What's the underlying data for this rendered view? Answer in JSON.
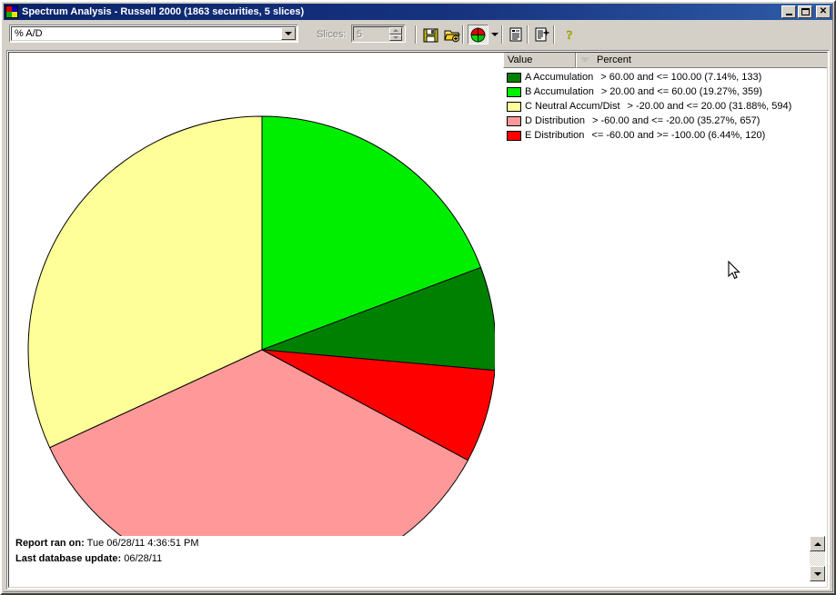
{
  "window": {
    "title": "Spectrum Analysis - Russell 2000 (1863 securities, 5 slices)",
    "app_icon": "pie-chart-icon",
    "buttons": {
      "minimize": "_",
      "maximize": "□",
      "close": "×"
    }
  },
  "toolbar": {
    "field_select": {
      "value": "% A/D",
      "icon": "chevron-down-icon"
    },
    "slices": {
      "label": "Slices:",
      "value": "5"
    },
    "buttons": [
      {
        "name": "save-button",
        "icon": "floppy-disk-icon"
      },
      {
        "name": "open-button",
        "icon": "open-folder-icon"
      },
      {
        "name": "pie-chart-view-button",
        "icon": "pie-chart-icon"
      },
      {
        "name": "chart-type-dropdown",
        "icon": "chevron-down-icon"
      },
      {
        "name": "report-view-button",
        "icon": "list-report-icon"
      },
      {
        "name": "detail-report-button",
        "icon": "add-report-icon"
      },
      {
        "name": "help-button",
        "icon": "question-mark-icon"
      }
    ]
  },
  "legend": {
    "columns": [
      "Value",
      "Percent"
    ],
    "sort_indicator": "sort-descending-icon",
    "rows": [
      {
        "color": "#008000",
        "name": "A Accumulation",
        "range": "> 60.00 and <= 100.00 (7.14%, 133)"
      },
      {
        "color": "#00ee00",
        "name": "B Accumulation",
        "range": "> 20.00 and <= 60.00 (19.27%, 359)"
      },
      {
        "color": "#ffff99",
        "name": "C Neutral Accum/Dist",
        "range": "> -20.00 and <= 20.00 (31.88%, 594)"
      },
      {
        "color": "#ff9999",
        "name": "D Distribution",
        "range": "> -60.00 and <= -20.00 (35.27%, 657)"
      },
      {
        "color": "#ff0000",
        "name": "E Distribution",
        "range": "<= -60.00 and >= -100.00 (6.44%, 120)"
      }
    ]
  },
  "footer": {
    "ran_label": "Report ran on:",
    "ran_value": "Tue 06/28/11 4:36:51 PM",
    "db_label": "Last database update:",
    "db_value": "06/28/11"
  },
  "scrollbar": {
    "up_icon": "scroll-up-arrow-icon",
    "down_icon": "scroll-down-arrow-icon"
  },
  "chart_data": {
    "type": "pie",
    "title": "Spectrum Analysis - Russell 2000",
    "total_securities": 1863,
    "slice_count": 5,
    "start_angle_deg": 0,
    "direction": "clockwise",
    "center": [
      278,
      327
    ],
    "radius": 257,
    "categories": [
      "B Accumulation",
      "A Accumulation",
      "E Distribution",
      "D Distribution",
      "C Neutral Accum/Dist"
    ],
    "values": [
      19.27,
      7.14,
      6.44,
      35.27,
      31.88
    ],
    "counts": [
      359,
      133,
      120,
      657,
      594
    ],
    "colors": [
      "#00ee00",
      "#008000",
      "#ff0000",
      "#ff9999",
      "#ffff99"
    ],
    "ranges": [
      "> 20.00 and <= 60.00",
      "> 60.00 and <= 100.00",
      "<= -60.00 and >= -100.00",
      "> -60.00 and <= -20.00",
      "> -20.00 and <= 20.00"
    ],
    "xlabel": "",
    "ylabel": "",
    "legend_position": "top-right",
    "grid": false
  }
}
